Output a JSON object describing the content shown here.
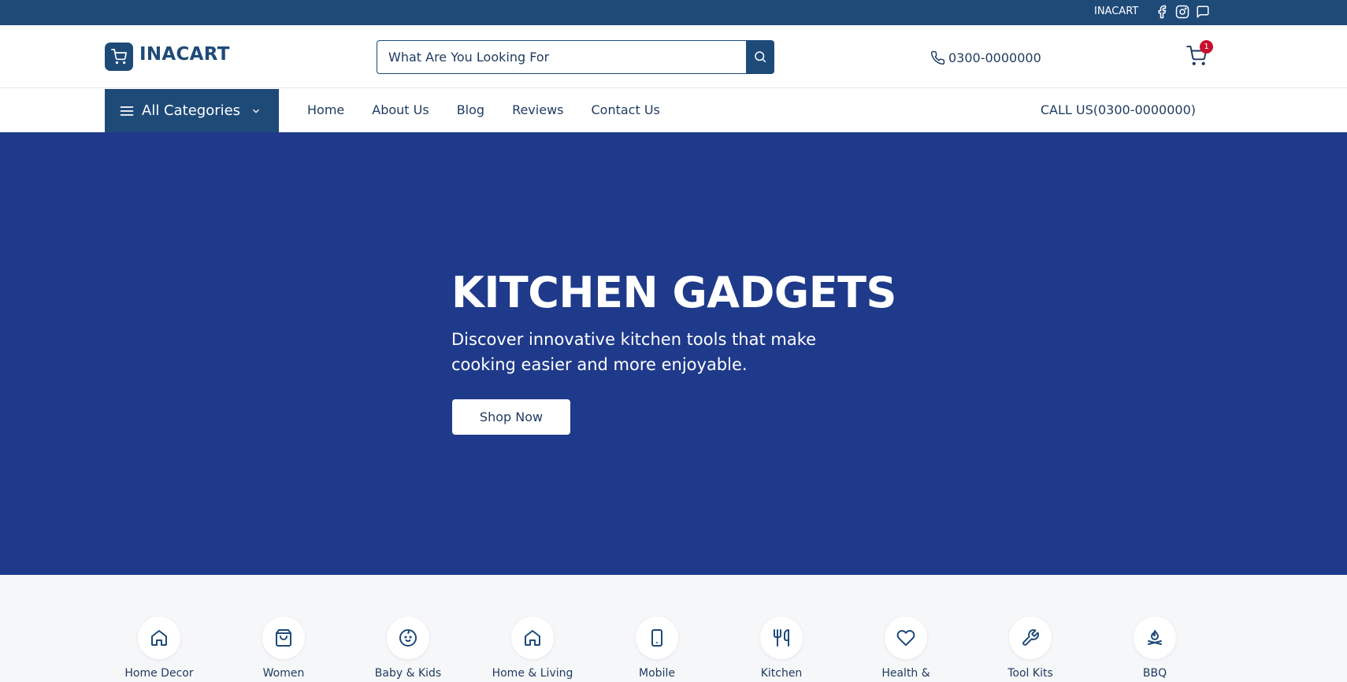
{
  "topbar": {
    "brand": "INACART",
    "social_icons": [
      "facebook-icon",
      "instagram-icon",
      "chat-icon"
    ]
  },
  "header": {
    "logo_text": "INACART",
    "search": {
      "placeholder": "What Are You Looking For",
      "value": ""
    },
    "phone": "0300-0000000",
    "cart_count": "1"
  },
  "nav": {
    "all_categories_label": "All Categories",
    "links": [
      "Home",
      "About Us",
      "Blog",
      "Reviews",
      "Contact Us"
    ],
    "call_us": "CALL US(0300-0000000)"
  },
  "hero": {
    "title": "KITCHEN GADGETS",
    "subtitle": "Discover innovative kitchen tools that make cooking easier and more enjoyable.",
    "cta_label": "Shop Now"
  },
  "categories": [
    {
      "label": "Home Decor",
      "icon": "home-icon"
    },
    {
      "label": "Women",
      "icon": "shopping-bag-icon"
    },
    {
      "label": "Baby & Kids",
      "icon": "baby-icon"
    },
    {
      "label": "Home & Living",
      "icon": "home-icon"
    },
    {
      "label": "Mobile",
      "icon": "mobile-icon"
    },
    {
      "label": "Kitchen",
      "icon": "utensils-icon"
    },
    {
      "label": "Health &",
      "icon": "heart-icon"
    },
    {
      "label": "Tool Kits",
      "icon": "wrench-icon"
    },
    {
      "label": "BBQ",
      "icon": "campfire-icon"
    }
  ],
  "colors": {
    "topbar": "#1e4a78",
    "primary": "#1e4a78",
    "hero_bg": "#1f3a8a",
    "badge": "#c8102e",
    "text": "#1e3a5f",
    "category_bg": "#f6f7f9"
  }
}
